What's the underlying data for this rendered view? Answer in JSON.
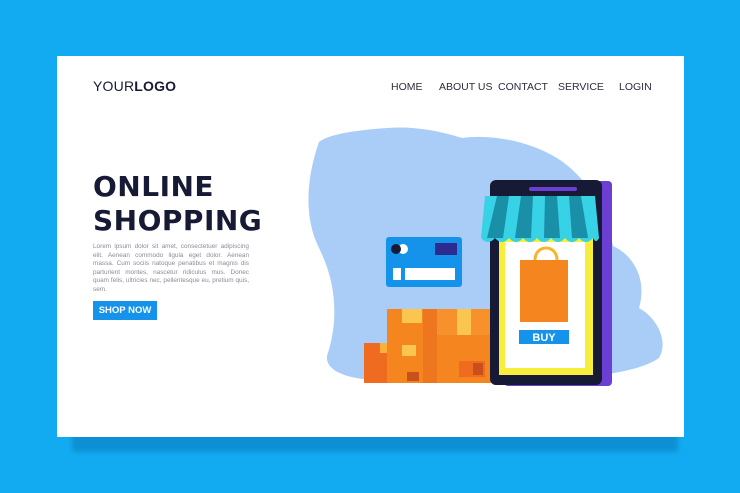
{
  "brand": {
    "logo_prefix": "YOUR",
    "logo_bold": "LOGO"
  },
  "nav": {
    "items": [
      {
        "label": "HOME"
      },
      {
        "label": "ABOUT US"
      },
      {
        "label": "CONTACT"
      },
      {
        "label": "SERVICE"
      },
      {
        "label": "LOGIN"
      }
    ]
  },
  "hero": {
    "title": "ONLINE\nSHOPPING",
    "body": "Lorem ipsum dolor sit amet, consectetuer adipiscing elit. Aenean commodo ligula eget dolor. Aenean massa. Cum sociis natoque penatibus et magnis dis parturient montes, nascetur ridiculus mus. Donec quam felis, ultricies nec, pellentesque eu, pretium quis, sem.",
    "cta_label": "SHOP NOW"
  },
  "illustration": {
    "buy_label": "BUY",
    "icons": [
      "credit-card-icon",
      "shopping-bag-icon",
      "awning-icon",
      "box-icon"
    ]
  },
  "colors": {
    "background": "#12aaf0",
    "page": "#ffffff",
    "blob": "#a9cdf7",
    "accent": "#1592ea",
    "title": "#161a34",
    "box": "#f5861f",
    "phone_frame": "#161a34",
    "phone_screen": "#f6ee3a"
  }
}
